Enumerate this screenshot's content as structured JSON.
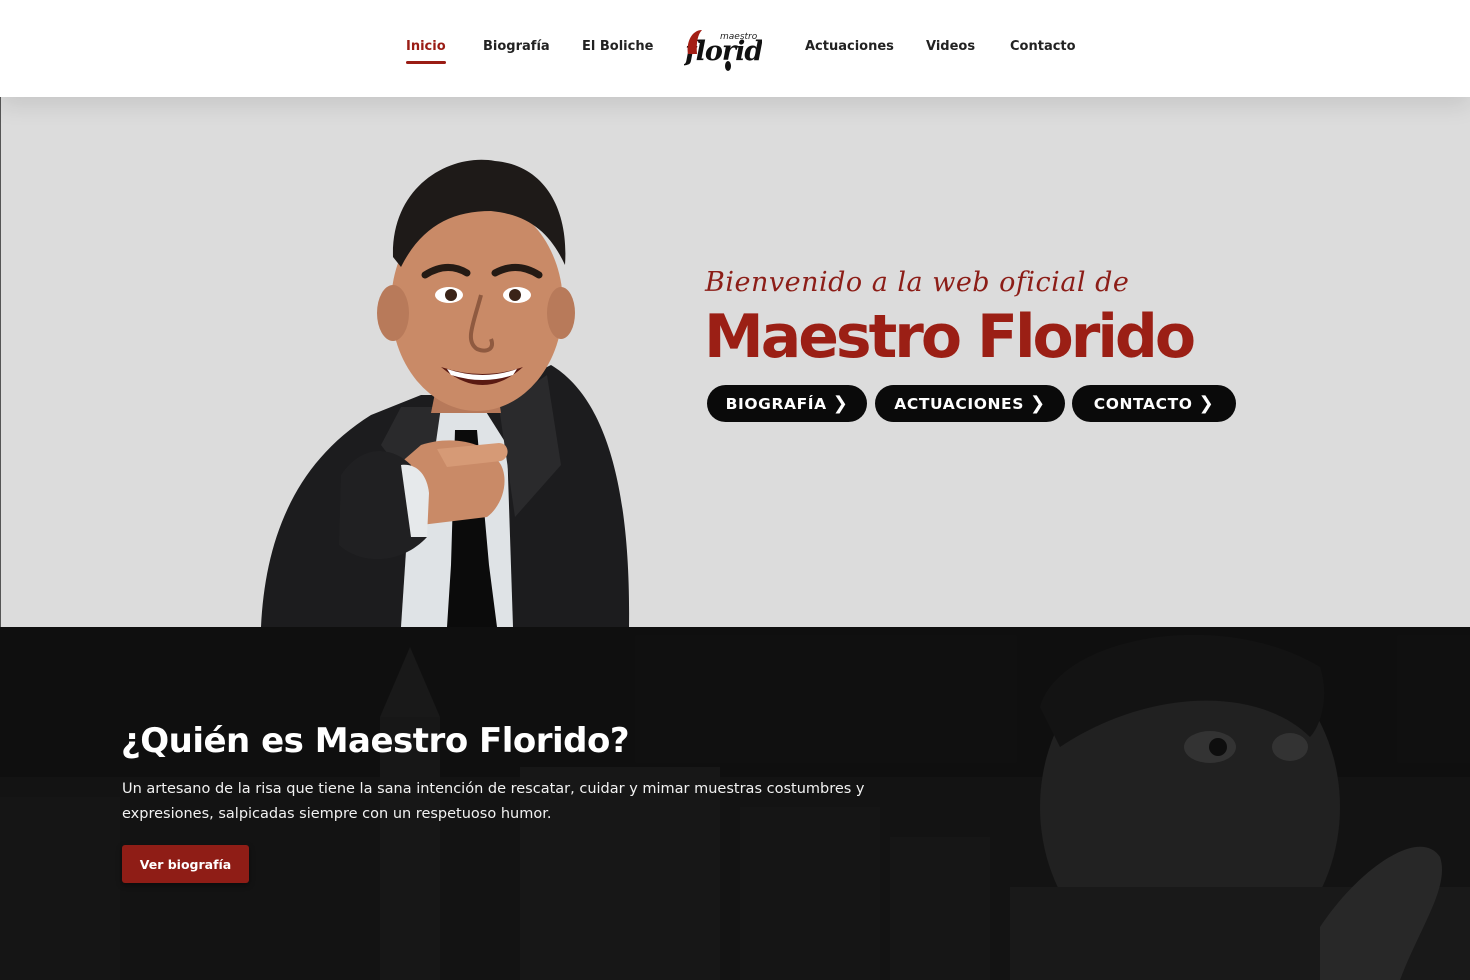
{
  "nav": {
    "items": [
      {
        "label": "Inicio",
        "active": true
      },
      {
        "label": "Biografía",
        "active": false
      },
      {
        "label": "El Boliche",
        "active": false
      },
      {
        "label": "Actuaciones",
        "active": false
      },
      {
        "label": "Videos",
        "active": false
      },
      {
        "label": "Contacto",
        "active": false
      }
    ],
    "logo": {
      "small_text": "maestro",
      "main_text": "florido"
    }
  },
  "hero": {
    "subtitle": "Bienvenido a la web oficial de",
    "title": "Maestro Florido",
    "buttons": [
      {
        "label": "BIOGRAFÍA",
        "icon": "chevron-right-icon"
      },
      {
        "label": "ACTUACIONES",
        "icon": "chevron-right-icon"
      },
      {
        "label": "CONTACTO",
        "icon": "chevron-right-icon"
      }
    ],
    "chevron_glyph": "❯"
  },
  "about": {
    "title": "¿Quién es Maestro Florido?",
    "text": "Un artesano de la risa que tiene la sana intención de rescatar, cuidar y mimar muestras costumbres y expresiones, salpicadas siempre con un respetuoso humor.",
    "button_label": "Ver biografía"
  },
  "colors": {
    "accent": "#9b1f15",
    "hero_bg": "#dcdcdc",
    "dark_bg": "#131313",
    "button_dark": "#0a0a0a"
  }
}
